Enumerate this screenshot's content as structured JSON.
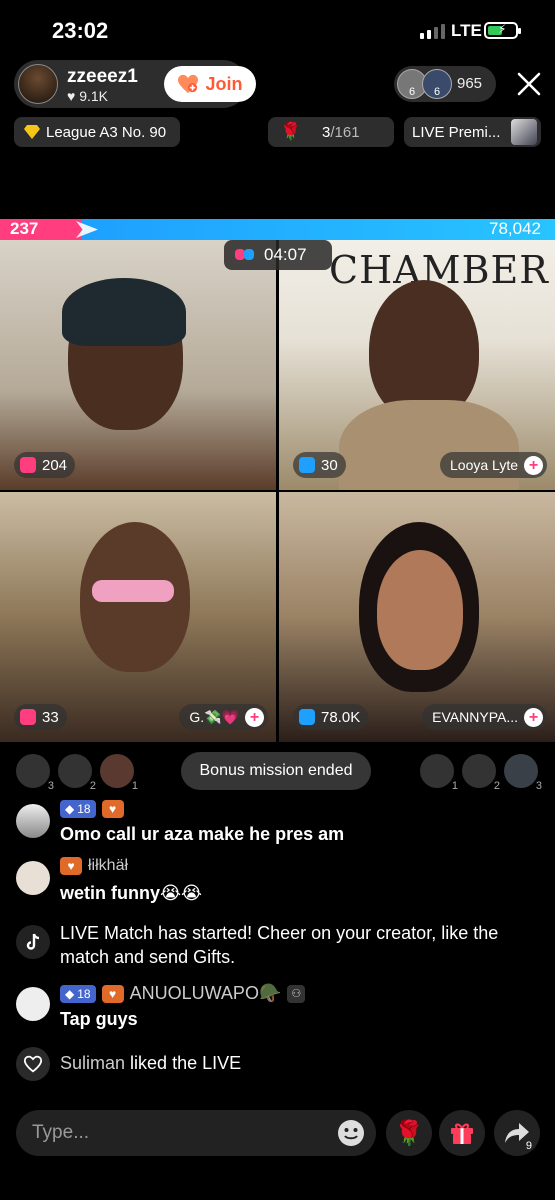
{
  "status_bar": {
    "time": "23:02",
    "network": "LTE"
  },
  "host": {
    "name": "zzeeez1",
    "likes": "9.1K",
    "join_label": "Join"
  },
  "viewers": {
    "count": "965",
    "badges": [
      "6",
      "6"
    ]
  },
  "tags": {
    "league": "League A3 No. 90",
    "rank_current": "3",
    "rank_total": "/161",
    "live_premium": "LIVE Premi..."
  },
  "battle": {
    "left_score": "237",
    "right_score": "78,042",
    "timer": "04:07",
    "left_color": "#ff3d7f",
    "right_color": "#1ea0ff"
  },
  "cells": [
    {
      "score": "204",
      "name": ""
    },
    {
      "score": "30",
      "name": "Looya Lyte",
      "bg_text": "CHAMBER"
    },
    {
      "score": "33",
      "name": "G.💸💗"
    },
    {
      "score": "78.0K",
      "name": "EVANNYPA..."
    }
  ],
  "rank_row": {
    "left": [
      "3",
      "2",
      "1"
    ],
    "right": [
      "1",
      "2",
      "3"
    ],
    "banner": "Bonus mission ended"
  },
  "chat": [
    {
      "level": "18",
      "user": "",
      "text": "Omo call ur aza make he pres am"
    },
    {
      "user": "łiłkhäł",
      "text": "wetin funny😭😭"
    },
    {
      "text": "LIVE Match has started! Cheer on your creator, like the match and send Gifts."
    },
    {
      "level": "18",
      "user": "ANUOLUWAPO🪖",
      "text": "Tap guys"
    },
    {
      "user": "Suliman",
      "action": "liked the LIVE"
    }
  ],
  "bottom": {
    "input_placeholder": "Type...",
    "share_count": "9"
  }
}
